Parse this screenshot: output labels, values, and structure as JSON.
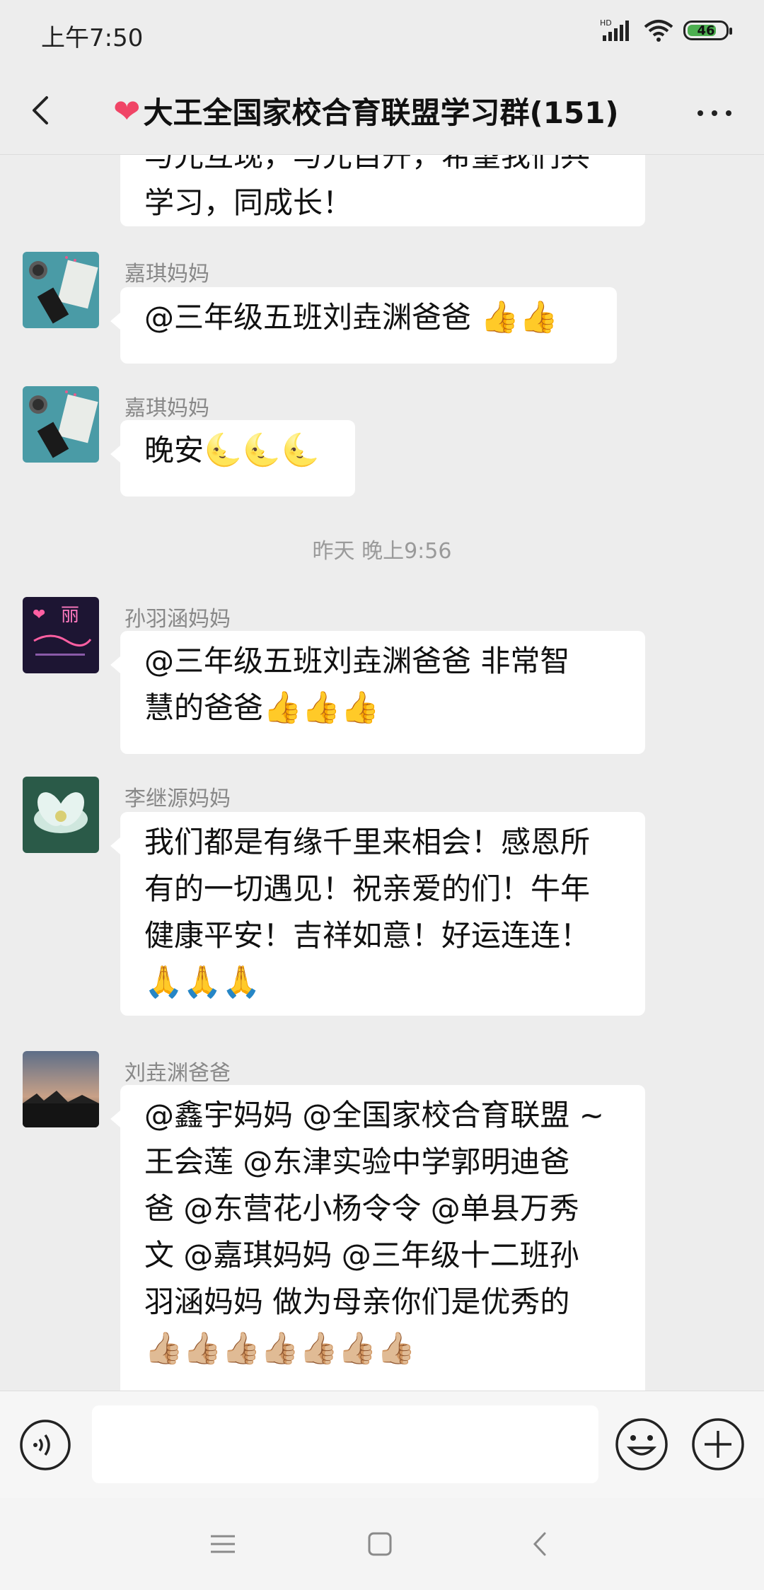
{
  "status_bar": {
    "time": "上午7:50",
    "network": "HD",
    "battery": "46"
  },
  "header": {
    "title": "大王全国家校合育联盟学习群(151)"
  },
  "messages": [
    {
      "id": "m0",
      "text": "学习，同成长！",
      "partial_top": "与光互现，与光自开，希望我们共"
    },
    {
      "id": "m1",
      "sender": "嘉琪妈妈",
      "text": "@三年级五班刘垚渊爸爸 ",
      "emoji": "👍👍"
    },
    {
      "id": "m2",
      "sender": "嘉琪妈妈",
      "text": "晚安",
      "emoji": "🌜🌜🌜"
    },
    {
      "id": "ts",
      "timestamp": "昨天 晚上9:56"
    },
    {
      "id": "m3",
      "sender": "孙羽涵妈妈",
      "line1": "@三年级五班刘垚渊爸爸  非常智",
      "line2": "慧的爸爸",
      "emoji": "👍👍👍",
      "avatar_text": "丽"
    },
    {
      "id": "m4",
      "sender": "李继源妈妈",
      "line1": "我们都是有缘千里来相会！感恩所",
      "line2": "有的一切遇见！祝亲爱的们！牛年",
      "line3": "健康平安！吉祥如意！好运连连！",
      "emoji": "🙏🙏🙏"
    },
    {
      "id": "m5",
      "sender": "刘垚渊爸爸",
      "line1": "@鑫宇妈妈  @全国家校合育联盟 ~",
      "line2": "王会莲  @东津实验中学郭明迪爸",
      "line3": "爸  @东营花小杨令令  @单县万秀",
      "line4": "文  @嘉琪妈妈  @三年级十二班孙",
      "line5": "羽涵妈妈  做为母亲你们是优秀的",
      "emoji": "👍🏼👍🏼👍🏼👍🏼👍🏼👍🏼👍🏼"
    }
  ],
  "input": {
    "placeholder": ""
  }
}
